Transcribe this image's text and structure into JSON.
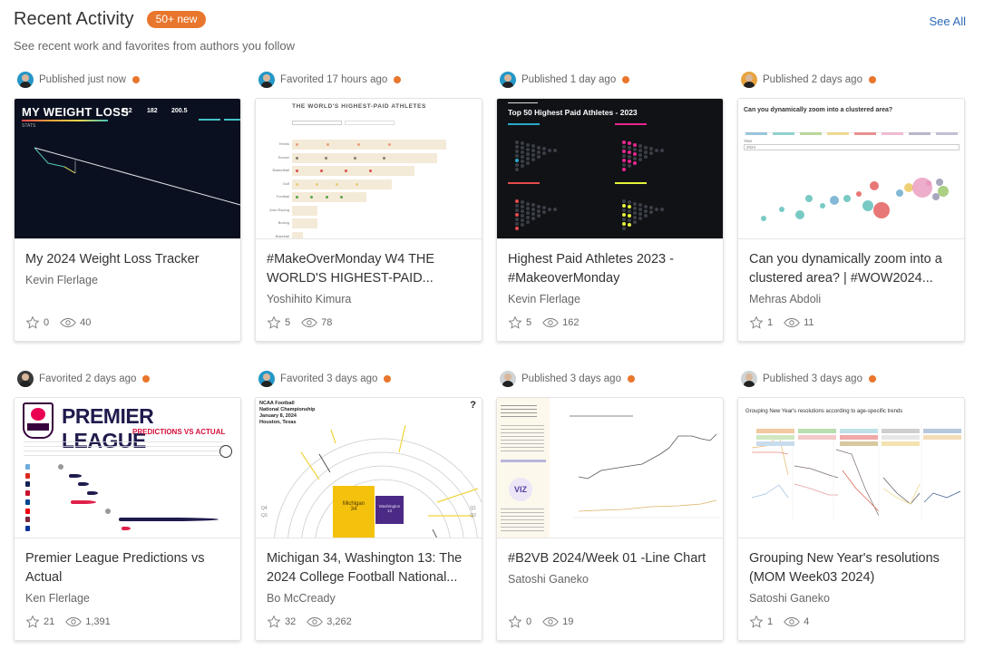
{
  "header": {
    "title": "Recent Activity",
    "badge": "50+ new",
    "subtitle": "See recent work and favorites from authors you follow",
    "see_all": "See All"
  },
  "colors": {
    "accent_orange": "#e8762c",
    "link_blue": "#2d6bb6"
  },
  "cards": [
    {
      "activity": "Published just now",
      "title": "My 2024 Weight Loss Tracker",
      "author": "Kevin Flerlage",
      "favorites": "0",
      "views": "40",
      "thumbnail": {
        "heading": "MY WEIGHT LOSS",
        "sub": "STATS",
        "kpis": [
          "212",
          "182",
          "200.5"
        ]
      }
    },
    {
      "activity": "Favorited 17 hours ago",
      "title": "#MakeOverMonday W4 THE WORLD'S HIGHEST-PAID...",
      "author": "Yoshihito Kimura",
      "favorites": "5",
      "views": "78",
      "thumbnail": {
        "heading": "THE WORLD'S HIGHEST-PAID ATHLETES",
        "rows": [
          "Tennis",
          "Soccer",
          "Basketball",
          "Golf",
          "Football",
          "Auto Racing",
          "Boxing",
          "Baseball"
        ]
      }
    },
    {
      "activity": "Published 1 day ago",
      "title": "Highest Paid Athletes 2023 - #MakeoverMonday",
      "author": "Kevin Flerlage",
      "favorites": "5",
      "views": "162",
      "thumbnail": {
        "heading": "Top 50 Highest Paid Athletes - 2023"
      }
    },
    {
      "activity": "Published 2 days ago",
      "title": "Can you dynamically zoom into a clustered area? | #WOW2024...",
      "author": "Mehras Abdoli",
      "favorites": "1",
      "views": "11",
      "thumbnail": {
        "heading": "Can you dynamically zoom into a clustered area?",
        "filter_label": "Year",
        "filter_value": "2024"
      }
    },
    {
      "activity": "Favorited 2 days ago",
      "title": "Premier League Predictions vs Actual",
      "author": "Ken Flerlage",
      "favorites": "21",
      "views": "1,391",
      "thumbnail": {
        "heading": "PREMIER LEAGUE",
        "sub": "PREDICTIONS VS ACTUAL"
      }
    },
    {
      "activity": "Favorited 3 days ago",
      "title": "Michigan 34, Washington 13: The 2024 College Football National...",
      "author": "Bo McCready",
      "favorites": "32",
      "views": "3,262",
      "thumbnail": {
        "lines": [
          "NCAA Football",
          "National Championship",
          "January 8, 2024",
          "Houston, Texas"
        ],
        "team_a": "Michigan",
        "score_a": "34",
        "team_b": "Washington",
        "score_b": "13",
        "quarters": [
          "Q4",
          "Q3",
          "Q1",
          "Q2"
        ]
      }
    },
    {
      "activity": "Published 3 days ago",
      "title": "#B2VB 2024/Week 01 -Line Chart",
      "author": "Satoshi Ganeko",
      "favorites": "0",
      "views": "19",
      "thumbnail": {
        "logo": "VIZ"
      }
    },
    {
      "activity": "Published 3 days ago",
      "title": "Grouping New Year's resolutions (MOM Week03 2024)",
      "author": "Satoshi Ganeko",
      "favorites": "1",
      "views": "4",
      "thumbnail": {
        "heading": "Grouping New Year's resolutions according to age-specific trends"
      }
    }
  ]
}
